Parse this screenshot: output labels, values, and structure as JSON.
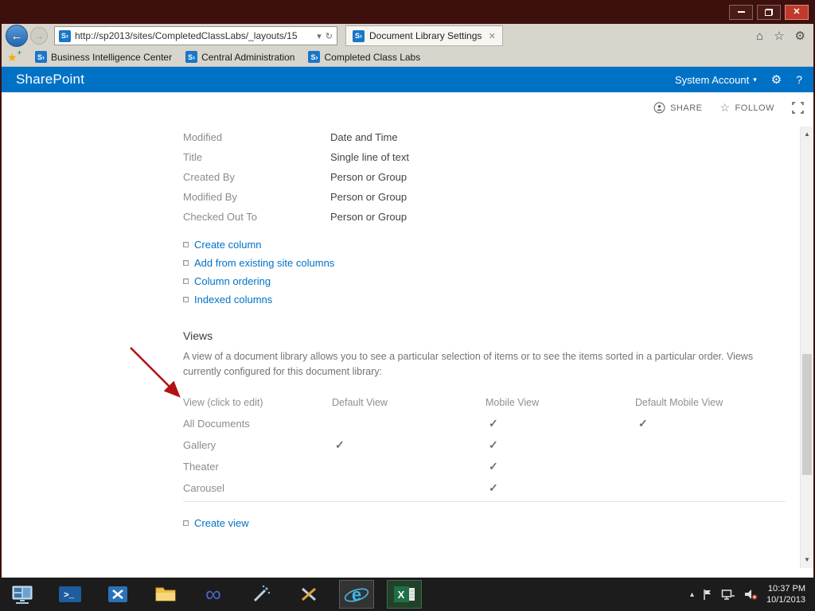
{
  "browser": {
    "url": "http://sp2013/sites/CompletedClassLabs/_layouts/15",
    "tab_title": "Document Library Settings",
    "favorites": [
      "Business Intelligence Center",
      "Central Administration",
      "Completed Class Labs"
    ]
  },
  "icons": {
    "sharepoint": "S›",
    "back": "←",
    "forward": "→",
    "refresh": "↻",
    "dropdown": "▾",
    "home": "⌂",
    "favorites_star": "☆",
    "settings_gear": "⚙",
    "tab_close": "✕",
    "window_close": "✕",
    "check": "✓",
    "scroll_up": "▲",
    "scroll_down": "▼",
    "tray_expand": "▴",
    "fav_add_star": "★",
    "fav_add_plus": "+",
    "caret_down": "▾",
    "infinity": "∞"
  },
  "suite": {
    "brand": "SharePoint",
    "account": "System Account",
    "help": "?"
  },
  "page_actions": {
    "share": "SHARE",
    "follow": "FOLLOW"
  },
  "columns": {
    "rows": [
      {
        "name": "Modified",
        "type": "Date and Time"
      },
      {
        "name": "Title",
        "type": "Single line of text"
      },
      {
        "name": "Created By",
        "type": "Person or Group"
      },
      {
        "name": "Modified By",
        "type": "Person or Group"
      },
      {
        "name": "Checked Out To",
        "type": "Person or Group"
      }
    ],
    "links": [
      "Create column",
      "Add from existing site columns",
      "Column ordering",
      "Indexed columns"
    ]
  },
  "views": {
    "heading": "Views",
    "description": "A view of a document library allows you to see a particular selection of items or to see the items sorted in a particular order. Views currently configured for this document library:",
    "headers": [
      "View (click to edit)",
      "Default View",
      "Mobile View",
      "Default Mobile View"
    ],
    "rows": [
      {
        "name": "All Documents",
        "default_view": false,
        "mobile_view": true,
        "default_mobile_view": true
      },
      {
        "name": "Gallery",
        "default_view": true,
        "mobile_view": true,
        "default_mobile_view": false
      },
      {
        "name": "Theater",
        "default_view": false,
        "mobile_view": true,
        "default_mobile_view": false
      },
      {
        "name": "Carousel",
        "default_view": false,
        "mobile_view": true,
        "default_mobile_view": false
      }
    ],
    "create_link": "Create view"
  },
  "taskbar": {
    "time": "10:37 PM",
    "date": "10/1/2013"
  },
  "colors": {
    "suite_blue": "#0072c6",
    "link_blue": "#0072c6",
    "titlebar": "#3e100d",
    "arrow_red": "#b21215"
  }
}
